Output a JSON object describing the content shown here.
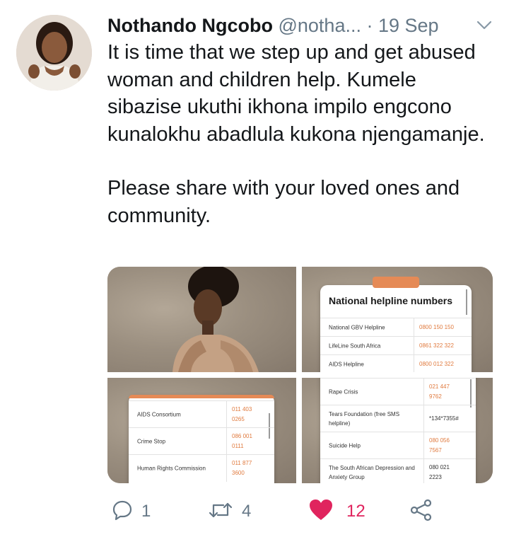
{
  "tweet": {
    "display_name": "Nothando Ngcobo",
    "handle": "@notha...",
    "separator": "·",
    "date": "19 Sep",
    "paragraphs": [
      "It is time that we step up and get abused woman and children help. Kumele sibazise ukuthi ikhona impilo engcono kunalokhu abadlula kukona njengamanje.",
      "Please share with your loved ones and community."
    ]
  },
  "media": {
    "card_title": "National helpline numbers",
    "image2_rows": [
      {
        "name": "National GBV Helpline",
        "number": "0800 150 150"
      },
      {
        "name": "LifeLine South Africa",
        "number": "0861 322 322"
      },
      {
        "name": "AIDS Helpline",
        "number": "0800 012 322"
      }
    ],
    "image3_rows": [
      {
        "name": "AIDS Consortium",
        "number": "011 403 0265"
      },
      {
        "name": "Crime Stop",
        "number": "086 001 0111"
      },
      {
        "name": "Human Rights Commission",
        "number": "011 877 3600"
      }
    ],
    "image4_rows": [
      {
        "name": "Rape Crisis",
        "number": "021 447 9762"
      },
      {
        "name": "Tears Foundation (free SMS helpline)",
        "number": "*134*7355#"
      },
      {
        "name": "Suicide Help",
        "number": "080 056 7567"
      },
      {
        "name": "The South African Depression and Anxiety Group",
        "number": "080 021 2223"
      }
    ]
  },
  "actions": {
    "reply_count": "1",
    "retweet_count": "4",
    "like_count": "12"
  },
  "colors": {
    "text": "#14171a",
    "secondary": "#657786",
    "like": "#e0245e",
    "accent_orange": "#e07a3e"
  }
}
